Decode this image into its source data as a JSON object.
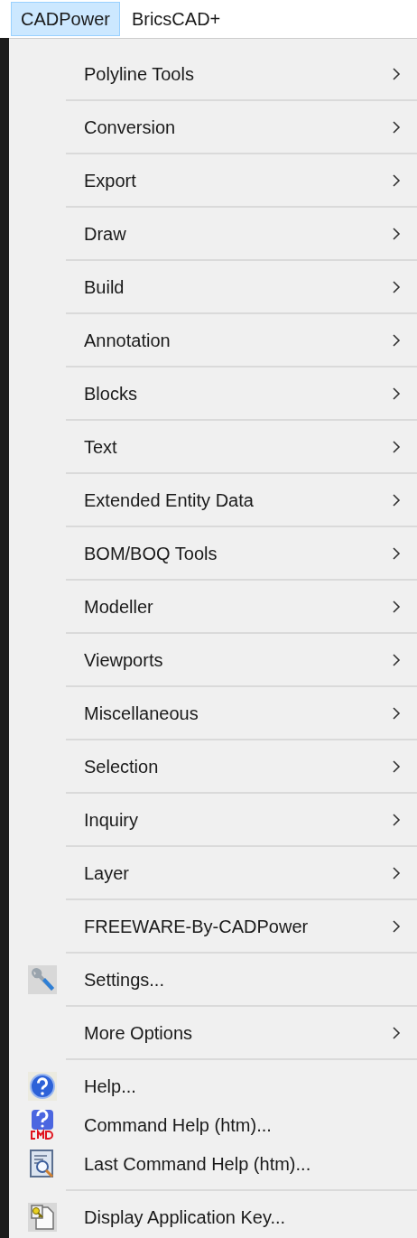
{
  "menubar": [
    {
      "label": "CADPower",
      "selected": true
    },
    {
      "label": "BricsCAD+",
      "selected": false
    }
  ],
  "menu": {
    "groups": [
      {
        "items": [
          {
            "label": "Polyline Tools",
            "kind": "submenu"
          }
        ]
      },
      {
        "items": [
          {
            "label": "Conversion",
            "kind": "submenu"
          }
        ]
      },
      {
        "items": [
          {
            "label": "Export",
            "kind": "submenu"
          }
        ]
      },
      {
        "items": [
          {
            "label": "Draw",
            "kind": "submenu"
          }
        ]
      },
      {
        "items": [
          {
            "label": "Build",
            "kind": "submenu"
          }
        ]
      },
      {
        "items": [
          {
            "label": "Annotation",
            "kind": "submenu"
          }
        ]
      },
      {
        "items": [
          {
            "label": "Blocks",
            "kind": "submenu"
          }
        ]
      },
      {
        "items": [
          {
            "label": "Text",
            "kind": "submenu"
          }
        ]
      },
      {
        "items": [
          {
            "label": "Extended Entity Data",
            "kind": "submenu"
          }
        ]
      },
      {
        "items": [
          {
            "label": "BOM/BOQ Tools",
            "kind": "submenu"
          }
        ]
      },
      {
        "items": [
          {
            "label": "Modeller",
            "kind": "submenu"
          }
        ]
      },
      {
        "items": [
          {
            "label": "Viewports",
            "kind": "submenu"
          }
        ]
      },
      {
        "items": [
          {
            "label": "Miscellaneous",
            "kind": "submenu"
          }
        ]
      },
      {
        "items": [
          {
            "label": "Selection",
            "kind": "submenu"
          }
        ]
      },
      {
        "items": [
          {
            "label": "Inquiry",
            "kind": "submenu"
          }
        ]
      },
      {
        "items": [
          {
            "label": "Layer",
            "kind": "submenu"
          }
        ]
      },
      {
        "items": [
          {
            "label": "FREEWARE-By-CADPower",
            "kind": "submenu"
          }
        ]
      },
      {
        "items": [
          {
            "label": "Settings...",
            "kind": "settings"
          }
        ]
      },
      {
        "items": [
          {
            "label": "More Options",
            "kind": "submenu"
          }
        ]
      },
      {
        "items": [
          {
            "label": "Help...",
            "kind": "help"
          },
          {
            "label": "Command Help (htm)...",
            "kind": "command-help"
          },
          {
            "label": "Last Command Help (htm)...",
            "kind": "last-command-help"
          }
        ]
      },
      {
        "items": [
          {
            "label": "Display Application Key...",
            "kind": "app-key"
          }
        ]
      }
    ]
  }
}
